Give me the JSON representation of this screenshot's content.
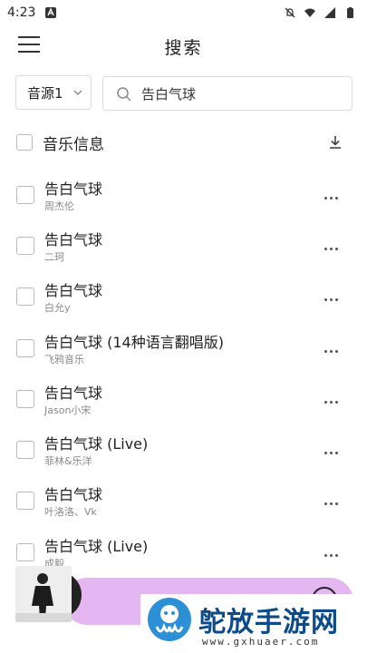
{
  "status_bar": {
    "time": "4:23"
  },
  "header": {
    "title": "搜索"
  },
  "search": {
    "source": "音源1",
    "query": "告白气球"
  },
  "list_header": {
    "label": "音乐信息"
  },
  "songs": [
    {
      "title": "告白气球",
      "artist": "周杰伦"
    },
    {
      "title": "告白气球",
      "artist": "二珂"
    },
    {
      "title": "告白气球",
      "artist": "白允y"
    },
    {
      "title": "告白气球 (14种语言翻唱版)",
      "artist": "飞鸦音乐"
    },
    {
      "title": "告白气球",
      "artist": "Jason小宋"
    },
    {
      "title": "告白气球 (Live)",
      "artist": "菲林&乐洋"
    },
    {
      "title": "告白气球",
      "artist": "叶洛洛、Vk"
    },
    {
      "title": "告白气球 (Live)",
      "artist": "成毅"
    }
  ],
  "watermark": {
    "brand": "鸵放手游网",
    "url": "www.gxhuaer.com"
  },
  "colors": {
    "player_bar": "#e4b7f2",
    "watermark_text": "#0c4a8a"
  }
}
